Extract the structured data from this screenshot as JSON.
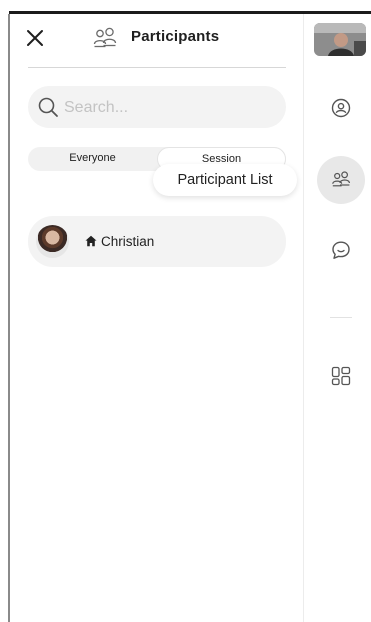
{
  "panel": {
    "title": "Participants",
    "search_placeholder": "Search...",
    "tabs": [
      {
        "label": "Everyone",
        "selected": false
      },
      {
        "label": "Session",
        "selected": true
      }
    ],
    "tooltip": "Participant List",
    "participants": [
      {
        "name": "Christian",
        "is_host": true
      }
    ]
  },
  "rail": {
    "items": [
      {
        "icon": "user-circle-icon"
      },
      {
        "icon": "participants-icon",
        "active": true
      },
      {
        "icon": "chat-icon"
      },
      {
        "icon": "apps-grid-icon"
      }
    ]
  },
  "colors": {
    "row_bg": "#f3f3f3",
    "active_rail_bg": "#e8e8e8",
    "text": "#1f1f1f"
  }
}
